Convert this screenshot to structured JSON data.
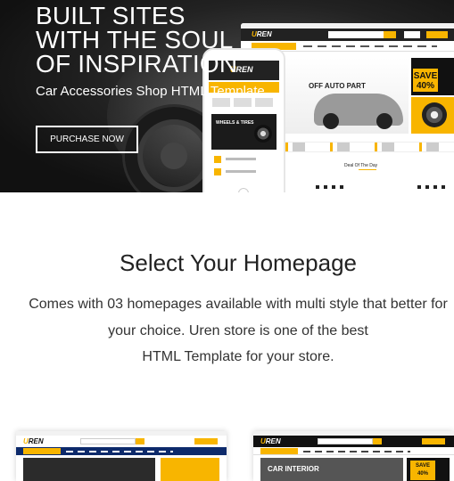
{
  "hero": {
    "title_lines": [
      "BUILT SITES",
      "WITH THE SOUL",
      "OF INSPIRATION"
    ],
    "subtitle": "Car Accessories Shop HTML Template",
    "purchase_label": "PURCHASE NOW"
  },
  "mock_desktop": {
    "logo_main": "U",
    "logo_rest": "REN",
    "headline": "OFF AUTO PART",
    "promo_save": "SAVE",
    "promo_pct": "40%",
    "deal_title": "Deal Of The Day"
  },
  "mock_phone": {
    "logo_main": "U",
    "logo_rest": "REN",
    "banner_text": "WHEELS & TIRES"
  },
  "section": {
    "title": "Select Your Homepage",
    "desc_lines": [
      "Comes with 03 homepages available with multi style that better for",
      "your choice. Uren store is one of the best",
      "HTML Template for your store."
    ]
  },
  "previews": {
    "one": {
      "logo_main": "U",
      "logo_rest": "REN"
    },
    "two": {
      "logo_main": "U",
      "logo_rest": "REN",
      "banner_text": "CAR INTERIOR",
      "save": "SAVE",
      "pct": "40%"
    }
  },
  "colors": {
    "accent": "#f8b500",
    "dark": "#111111",
    "navy": "#0d2a6b"
  }
}
